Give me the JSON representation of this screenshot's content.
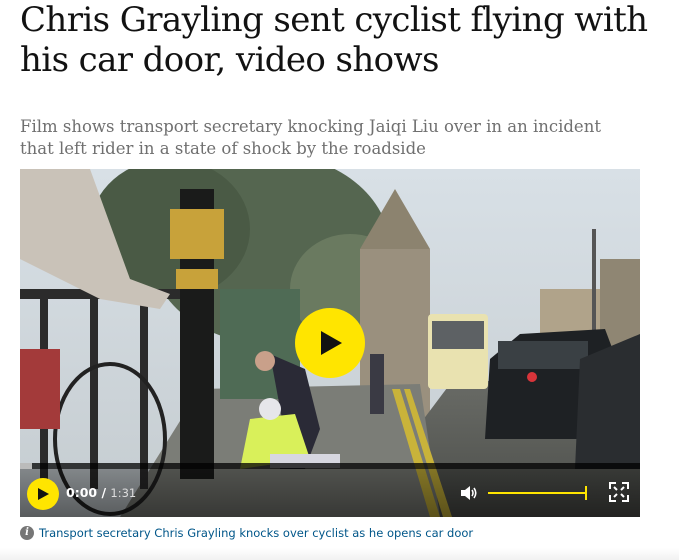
{
  "article": {
    "headline": "Chris Grayling sent cyclist flying with his car door, video shows",
    "standfirst": "Film shows transport secretary knocking Jaiqi Liu over in an incident that left rider in a state of shock by the roadside"
  },
  "video": {
    "current_time": "0:00",
    "separator": "/",
    "duration": "1:31",
    "progress_fraction": 0.0,
    "volume_fraction": 1.0,
    "accent_color": "#ffe500",
    "play_icon": "play-icon",
    "volume_icon": "volume-icon",
    "fullscreen_icon": "fullscreen-icon",
    "caption": "Transport secretary Chris Grayling knocks over cyclist as he opens car door",
    "caption_icon": "info-icon",
    "caption_icon_glyph": "i"
  }
}
